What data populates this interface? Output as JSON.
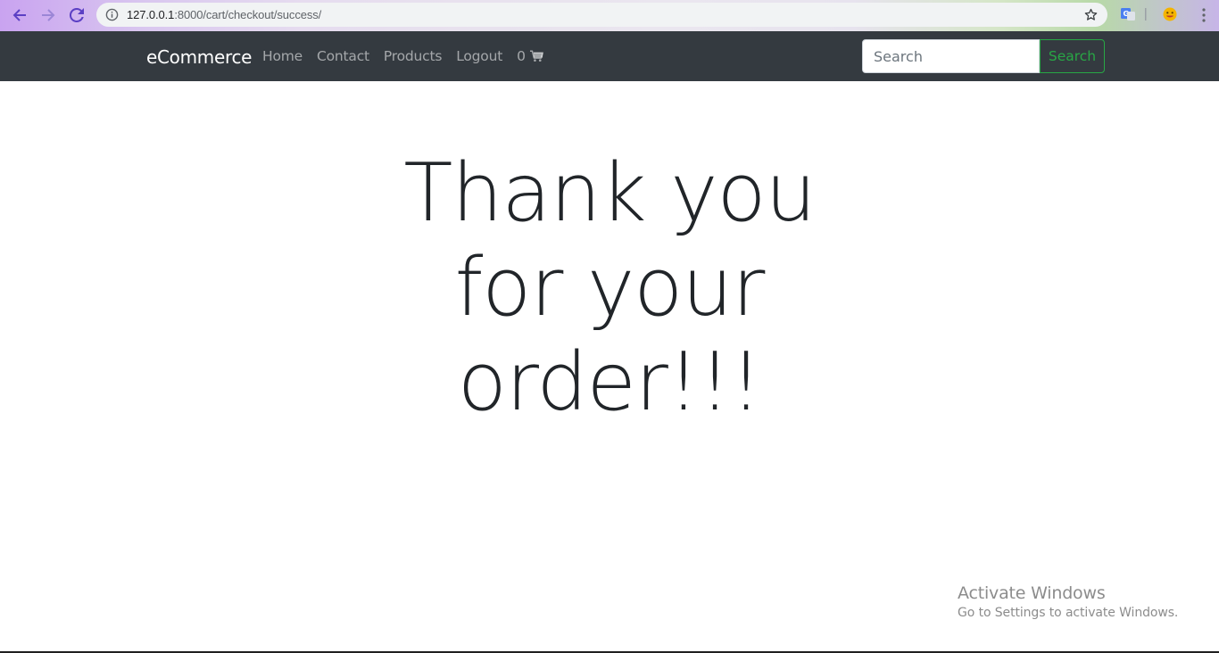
{
  "browser": {
    "url_host": "127.0.0.1",
    "url_path": ":8000/cart/checkout/success/"
  },
  "navbar": {
    "brand": "eCommerce",
    "links": [
      "Home",
      "Contact",
      "Products",
      "Logout"
    ],
    "cart_count": "0",
    "search": {
      "placeholder": "Search",
      "button_label": "Search"
    },
    "colors": {
      "background": "#343a40",
      "link": "rgba(255,255,255,0.55)",
      "success": "#28a745"
    }
  },
  "main": {
    "heading_lines": [
      "Thank you",
      "for your",
      "order!!!"
    ]
  },
  "watermark": {
    "title": "Activate Windows",
    "subtitle": "Go to Settings to activate Windows."
  }
}
